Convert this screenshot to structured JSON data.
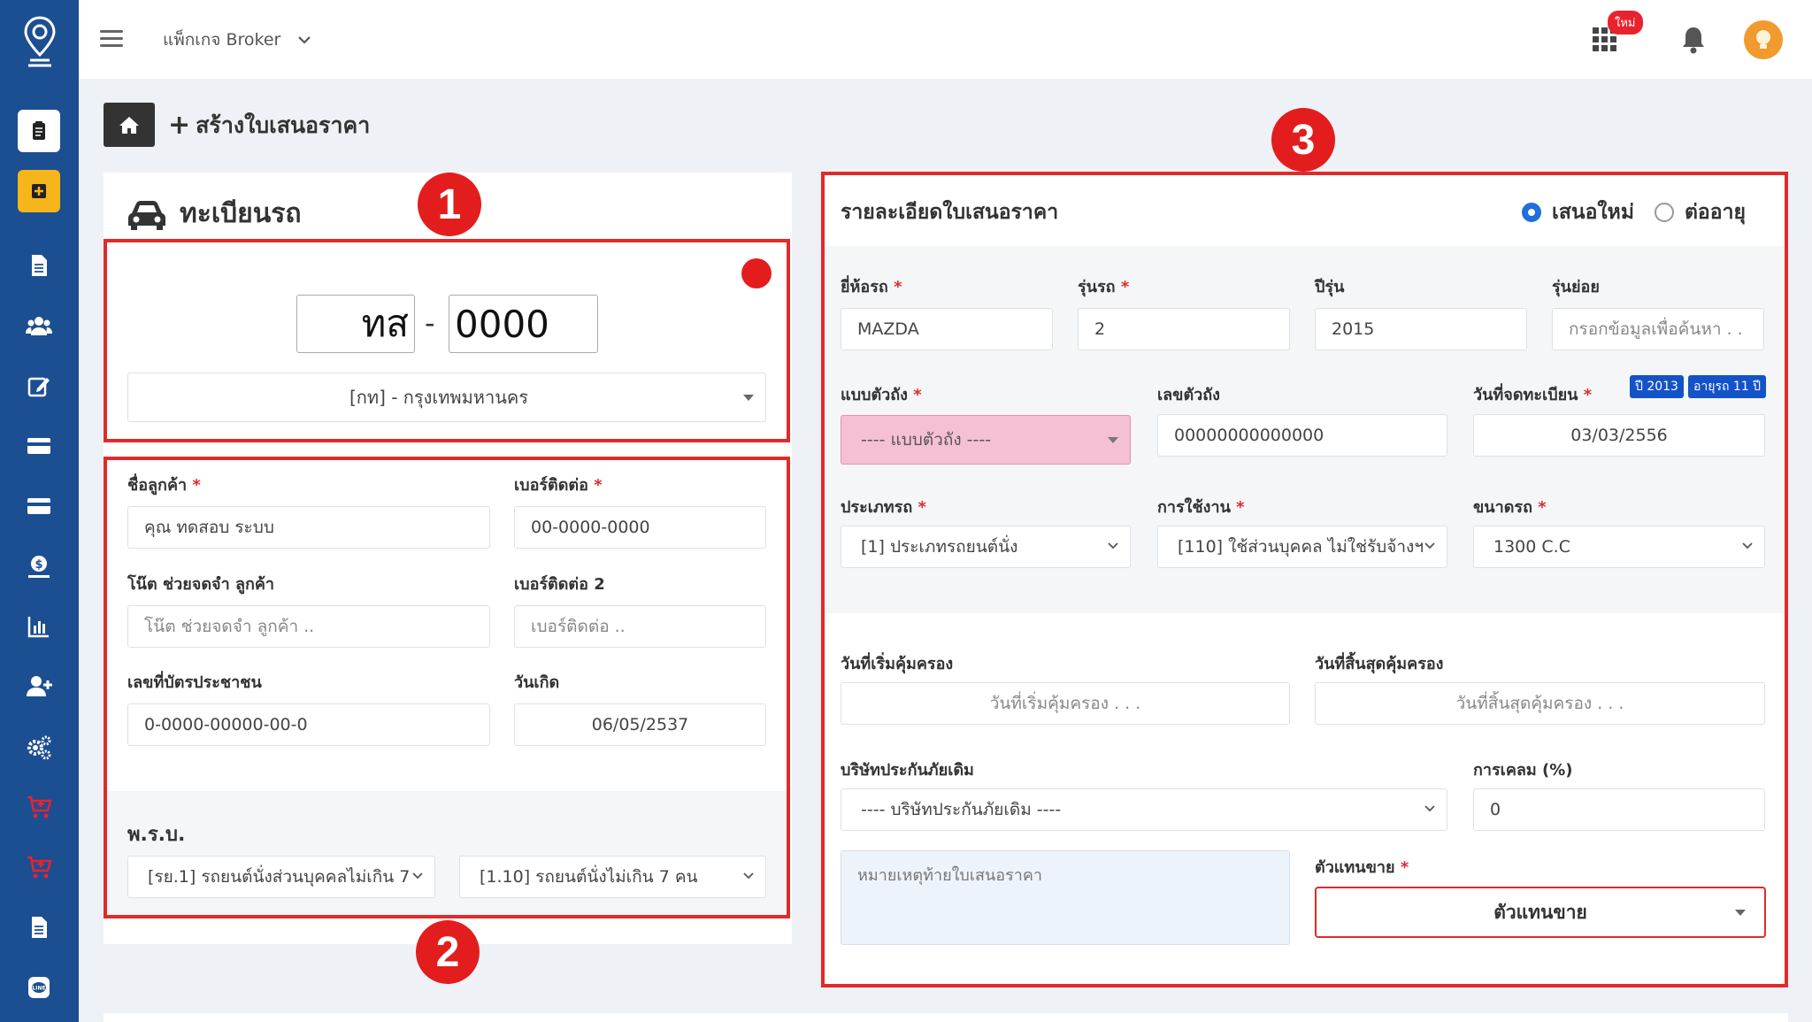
{
  "topbar": {
    "package_label": "แพ็กเกจ Broker",
    "new_badge": "ใหม่"
  },
  "breadcrumb": {
    "title": "สร้างใบเสนอราคา"
  },
  "markers": {
    "m1": "1",
    "m2": "2",
    "m3": "3"
  },
  "vehicle": {
    "title": "ทะเบียนรถ",
    "plate_prefix": "ทส",
    "plate_separator": "-",
    "plate_number": "0000",
    "province": "[กท] - กรุงเทพมหานคร"
  },
  "customer": {
    "name_label": "ชื่อลูกค้า",
    "name_value": "คุณ ทดสอบ ระบบ",
    "phone_label": "เบอร์ติดต่อ",
    "phone_value": "00-0000-0000",
    "note_label": "โน๊ต ช่วยจดจำ ลูกค้า",
    "note_placeholder": "โน๊ต ช่วยจดจำ ลูกค้า ..",
    "phone2_label": "เบอร์ติดต่อ 2",
    "phone2_placeholder": "เบอร์ติดต่อ ..",
    "idcard_label": "เลขที่บัตรประชาชน",
    "idcard_value": "0-0000-00000-00-0",
    "birth_label": "วันเกิด",
    "birth_value": "06/05/2537",
    "prb_label": "พ.ร.บ.",
    "prb_select1": "[รย.1] รถยนต์นั่งส่วนบุคคลไม่เกิน 7",
    "prb_select2": "[1.10] รถยนต์นั่งไม่เกิน 7 คน"
  },
  "quote": {
    "title": "รายละเอียดใบเสนอราคา",
    "radio_new": "เสนอใหม่",
    "radio_renew": "ต่ออายุ",
    "brand_label": "ยี่ห้อรถ",
    "brand_value": "MAZDA",
    "model_label": "รุ่นรถ",
    "model_value": "2",
    "year_label": "ปีรุ่น",
    "year_value": "2015",
    "submodel_label": "รุ่นย่อย",
    "submodel_placeholder": "กรอกข้อมูลเพื่อค้นหา . .",
    "body_label": "แบบตัวถัง",
    "body_value": "---- แบบตัวถัง ----",
    "chassis_label": "เลขตัวถัง",
    "chassis_value": "00000000000000",
    "regdate_label": "วันที่จดทะเบียน",
    "pill_year": "ปี 2013",
    "pill_age": "อายุรถ 11 ปี",
    "regdate_value": "03/03/2556",
    "type_label": "ประเภทรถ",
    "type_value": "[1] ประเภทรถยนต์นั่ง",
    "usage_label": "การใช้งาน",
    "usage_value": "[110] ใช้ส่วนบุคคล ไม่ใช่รับจ้างฯ",
    "size_label": "ขนาดรถ",
    "size_value": "1300 C.C",
    "start_label": "วันที่เริ่มคุ้มครอง",
    "start_placeholder": "วันที่เริ่มคุ้มครอง . . .",
    "end_label": "วันที่สิ้นสุดคุ้มครอง",
    "end_placeholder": "วันที่สิ้นสุดคุ้มครอง . . .",
    "insurer_label": "บริษัทประกันภัยเดิม",
    "insurer_value": "---- บริษัทประกันภัยเดิม ----",
    "claim_label": "การเคลม (%)",
    "claim_value": "0",
    "remark_placeholder": "หมายเหตุท้ายใบเสนอราคา",
    "agent_label": "ตัวแทนขาย",
    "agent_value": "ตัวแทนขาย"
  },
  "required_mark": "*"
}
